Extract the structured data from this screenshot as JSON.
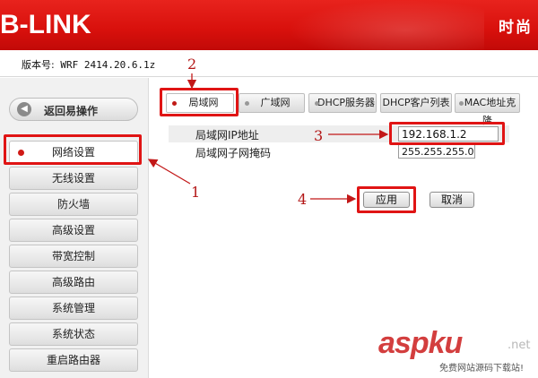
{
  "header": {
    "logo": "B-LINK",
    "slogan": "时尚"
  },
  "version": {
    "label": "版本号:",
    "value": "WRF 2414.20.6.1z"
  },
  "sidebar": {
    "back_label": "返回易操作",
    "back_icon": "left-arrow-icon",
    "items": [
      {
        "label": "网络设置",
        "active": true
      },
      {
        "label": "无线设置"
      },
      {
        "label": "防火墙"
      },
      {
        "label": "高级设置"
      },
      {
        "label": "带宽控制"
      },
      {
        "label": "高级路由"
      },
      {
        "label": "系统管理"
      },
      {
        "label": "系统状态"
      },
      {
        "label": "重启路由器"
      }
    ]
  },
  "tabs": [
    {
      "label": "局域网",
      "active": true
    },
    {
      "label": "广域网"
    },
    {
      "label": "DHCP服务器"
    },
    {
      "label": "DHCP客户列表"
    },
    {
      "label": "MAC地址克隆"
    }
  ],
  "form": {
    "lan_ip_label": "局域网IP地址",
    "lan_ip_value": "192.168.1.2",
    "subnet_label": "局域网子网掩码",
    "subnet_value": "255.255.255.0"
  },
  "buttons": {
    "apply": "应用",
    "cancel": "取消"
  },
  "annotations": {
    "n1": "1",
    "n2": "2",
    "n3": "3",
    "n4": "4",
    "color": "#e01414"
  },
  "watermark": {
    "main": "aspku",
    "suffix": ".net",
    "sub": "免费网站源码下载站!"
  },
  "colors": {
    "header": "#d8100c",
    "accent_dot": "#d01a16"
  }
}
